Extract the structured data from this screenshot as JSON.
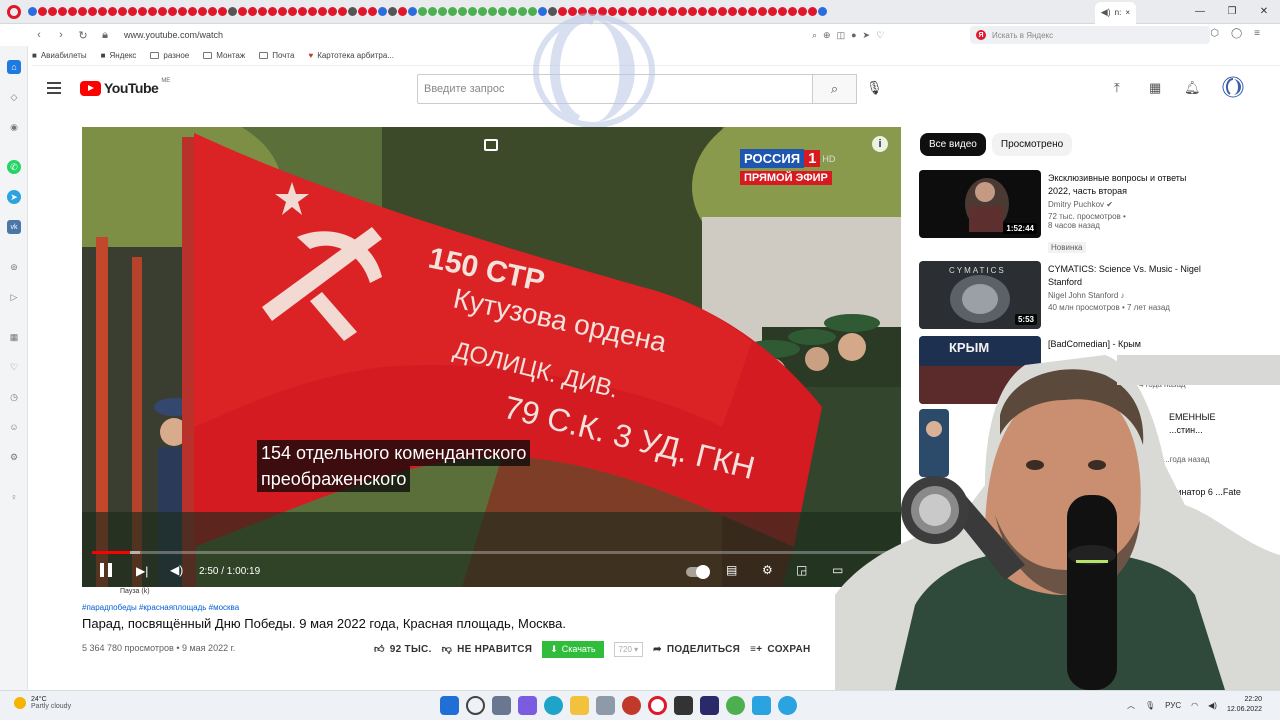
{
  "browser": {
    "url": "www.youtube.com/watch",
    "active_tab_label": "n:",
    "yandex_search_placeholder": "Искать в Яндекс",
    "yandex_letter": "Я",
    "bookmarks": [
      "Авиабилеты",
      "Яндекс",
      "разное",
      "Монтаж",
      "Почта",
      "Картотека арбитра..."
    ]
  },
  "youtube": {
    "logo_text": "YouTube",
    "logo_region": "ME",
    "search_placeholder": "Введите запрос"
  },
  "player": {
    "channel_name": "РОССИЯ",
    "channel_number": "1",
    "channel_hd": "HD",
    "live_label": "ПРЯМОЙ ЭФИР",
    "subtitle_line1": "154 отдельного комендантского",
    "subtitle_line2": "преображенского",
    "time": "2:50 / 1:00:19",
    "progress_fraction": 0.047,
    "buffered_fraction": 0.06,
    "pause_tooltip": "Пауза (k)",
    "flag_texts": [
      "150 СТР",
      "Кутузова ордена",
      "ДОЛИЦК. ДИВ.",
      "79 С.К. 3 УД. ГКН"
    ]
  },
  "video": {
    "hashtags": "#парадпобеды #краснаяплощадь #москва",
    "title": "Парад, посвящённый Дню Победы. 9 мая 2022 года, Красная площадь, Москва.",
    "views_date": "5 364 780 просмотров • 9 мая 2022 г.",
    "likes": "92 ТЫС.",
    "dislike_label": "НЕ НРАВИТСЯ",
    "download_label": "Скачать",
    "quality": "720",
    "share_label": "ПОДЕЛИТЬСЯ",
    "save_label": "СОХРАН"
  },
  "recommendations": {
    "chips": [
      "Все видео",
      "Просмотрено"
    ],
    "items": [
      {
        "title": "Эксклюзивные вопросы и ответы 2022, часть вторая",
        "channel": "Dmitry Puchkov",
        "meta1": "72 тыс. просмотров •",
        "meta2": "8 часов назад",
        "badge": "Новинка",
        "duration": "1:52:44"
      },
      {
        "title": "CYMATICS: Science Vs. Music - Nigel Stanford",
        "channel": "Nigel John Stanford",
        "meta1": "40 млн просмотров • 7 лет назад",
        "duration": "5:53",
        "thumb_text": "CYMATICS"
      },
      {
        "title": "[BadComedian] - Крым",
        "channel": "",
        "meta1": "4 года назад",
        "thumb_text": "КРЫМ"
      },
      {
        "title": "ЕМЕННЫЕ ...стин...",
        "meta1": "...года назад"
      },
      {
        "title": "...инатор 6 ...Fate la..."
      }
    ]
  },
  "taskbar": {
    "temperature": "24°C",
    "weather": "Partly cloudy",
    "language": "РУС",
    "time": "22:20",
    "date": "12.06.2022"
  },
  "colors": {
    "youtube_red": "#ff0000",
    "flag_red": "#d51b22",
    "download_green": "#2fbd3b",
    "link_blue": "#065fd4"
  }
}
